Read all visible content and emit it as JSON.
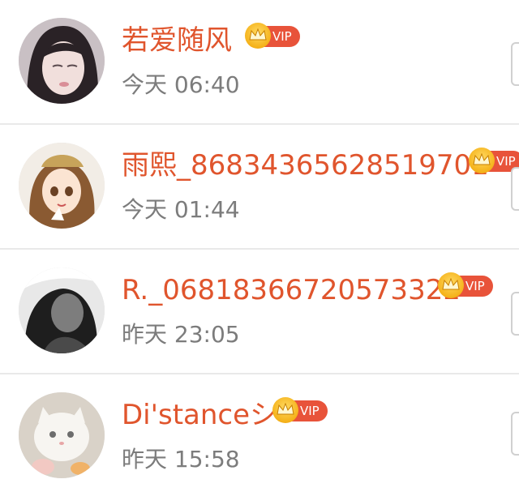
{
  "users": [
    {
      "name": "若爱随风",
      "badge": "VIP",
      "time": "今天 06:40"
    },
    {
      "name": "雨熙_86834365628519701",
      "badge": "VIP",
      "time": "今天 01:44"
    },
    {
      "name": "R._06818366720573322",
      "badge": "VIP",
      "time": "昨天 23:05"
    },
    {
      "name": "Di'stanceシ",
      "badge": "VIP",
      "time": "昨天 15:58"
    }
  ],
  "colors": {
    "name": "#e0552d",
    "vip_badge": "#e8533a",
    "time": "#7c7c7c",
    "divider": "#e9e9e9"
  },
  "icons": [
    "avatar",
    "crown-icon",
    "follow-button"
  ]
}
